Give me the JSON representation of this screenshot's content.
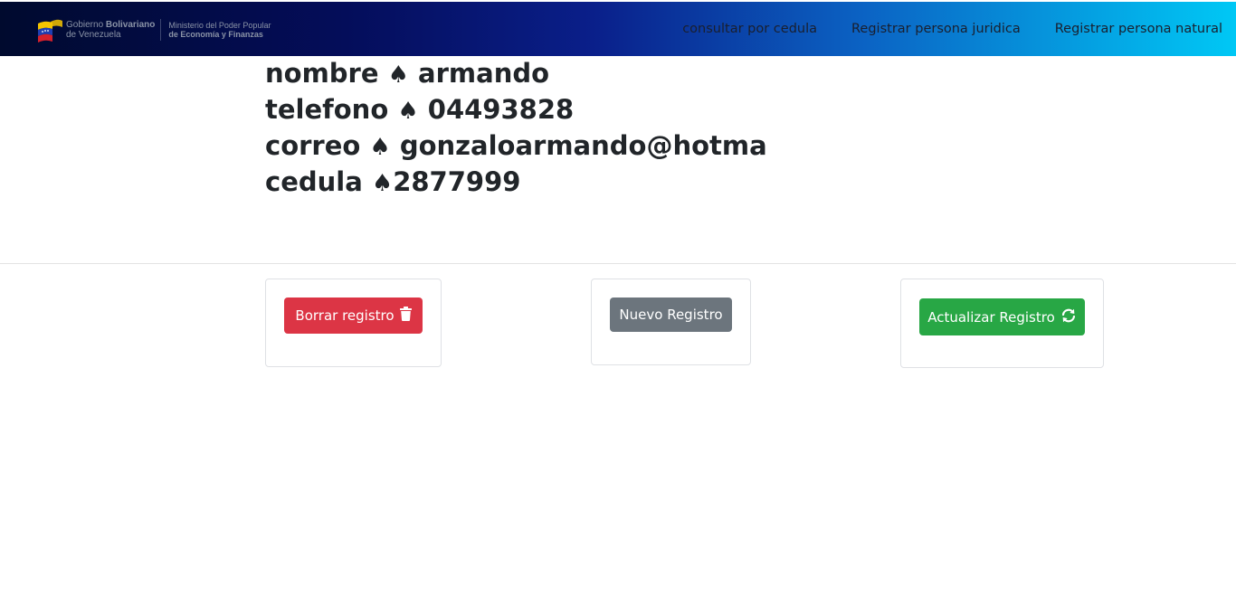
{
  "header": {
    "brand": {
      "line1_prefix": "Gobierno ",
      "line1_bold": "Bolivariano",
      "line2": "de Venezuela",
      "ministry_line1": "Ministerio del Poder Popular",
      "ministry_line2": "de Economía y Finanzas"
    },
    "nav": [
      {
        "label": "consultar por cedula"
      },
      {
        "label": "Registrar persona juridica"
      },
      {
        "label": "Registrar persona natural"
      }
    ]
  },
  "record": {
    "rows": [
      {
        "label": "nombre ",
        "separator": "♠",
        "value": " armando"
      },
      {
        "label": "telefono ",
        "separator": "♠",
        "value": " 04493828"
      },
      {
        "label": "correo ",
        "separator": "♠",
        "value": " gonzaloarmando@hotma"
      },
      {
        "label": "cedula ",
        "separator": "♠",
        "value": "2877999"
      }
    ]
  },
  "actions": {
    "delete_label": "Borrar registro",
    "new_label": "Nuevo Registro",
    "update_label": "Actualizar Registro",
    "delete_icon": "trash-icon",
    "update_icon": "sync-icon"
  },
  "colors": {
    "danger": "#dc3545",
    "secondary": "#6c757d",
    "success": "#28a745"
  }
}
